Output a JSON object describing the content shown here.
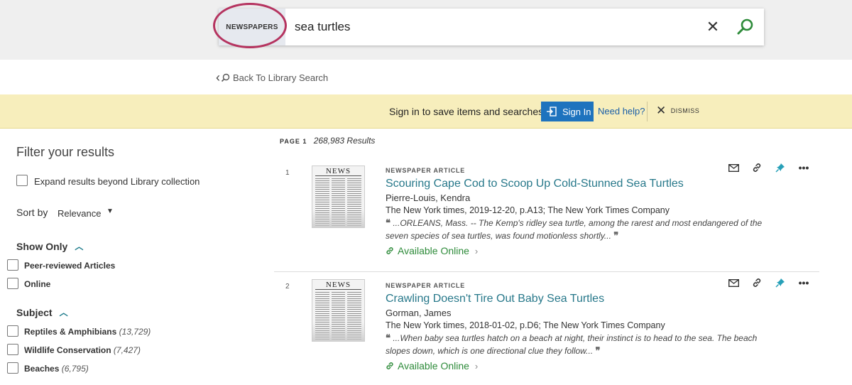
{
  "search": {
    "scope": "NEWSPAPERS",
    "query": "sea turtles"
  },
  "nav": {
    "back_label": "Back To Library Search"
  },
  "banner": {
    "message": "Sign in to save items and searches",
    "signin_label": "Sign In",
    "help_label": "Need help?",
    "dismiss_label": "DISMISS"
  },
  "sidebar": {
    "title": "Filter your results",
    "expand_label": "Expand results beyond Library collection",
    "sort_label": "Sort by",
    "sort_value": "Relevance",
    "show_only": {
      "heading": "Show Only",
      "items": [
        {
          "label": "Peer-reviewed Articles"
        },
        {
          "label": "Online"
        }
      ]
    },
    "subject": {
      "heading": "Subject",
      "items": [
        {
          "label": "Reptiles & Amphibians",
          "count": "(13,729)"
        },
        {
          "label": "Wildlife Conservation",
          "count": "(7,427)"
        },
        {
          "label": "Beaches",
          "count": "(6,795)"
        }
      ]
    }
  },
  "results_header": {
    "page": "PAGE 1",
    "count": "268,983 Results"
  },
  "results": [
    {
      "number": "1",
      "thumb_label": "NEWS",
      "type": "NEWSPAPER ARTICLE",
      "title": "Scouring Cape Cod to Scoop Up Cold-Stunned Sea Turtles",
      "author": "Pierre-Louis, Kendra",
      "source": "The New York times, 2019-12-20, p.A13; The New York Times Company",
      "snippet": "...ORLEANS, Mass. -- The Kemp's ridley sea turtle, among the rarest and most endangered of the seven species of sea turtles, was found motionless shortly...",
      "availability": "Available Online"
    },
    {
      "number": "2",
      "thumb_label": "NEWS",
      "type": "NEWSPAPER ARTICLE",
      "title": "Crawling Doesn't Tire Out Baby Sea Turtles",
      "author": "Gorman, James",
      "source": "The New York times, 2018-01-02, p.D6; The New York Times Company",
      "snippet": "...When baby sea turtles hatch on a beach at night, their instinct is to head to the sea. The beach slopes down, which is one directional clue they follow...",
      "availability": "Available Online"
    }
  ],
  "colors": {
    "accent_scope_ring": "#b5335f",
    "link_teal": "#27788a",
    "available_green": "#2e8b3a",
    "signin_blue": "#1e73be",
    "banner_yellow": "#f7eebc"
  },
  "icons": {
    "clear": "close-icon",
    "search": "search-icon",
    "email": "envelope-icon",
    "permalink": "link-icon",
    "pin": "pin-icon",
    "more": "ellipsis-icon"
  }
}
